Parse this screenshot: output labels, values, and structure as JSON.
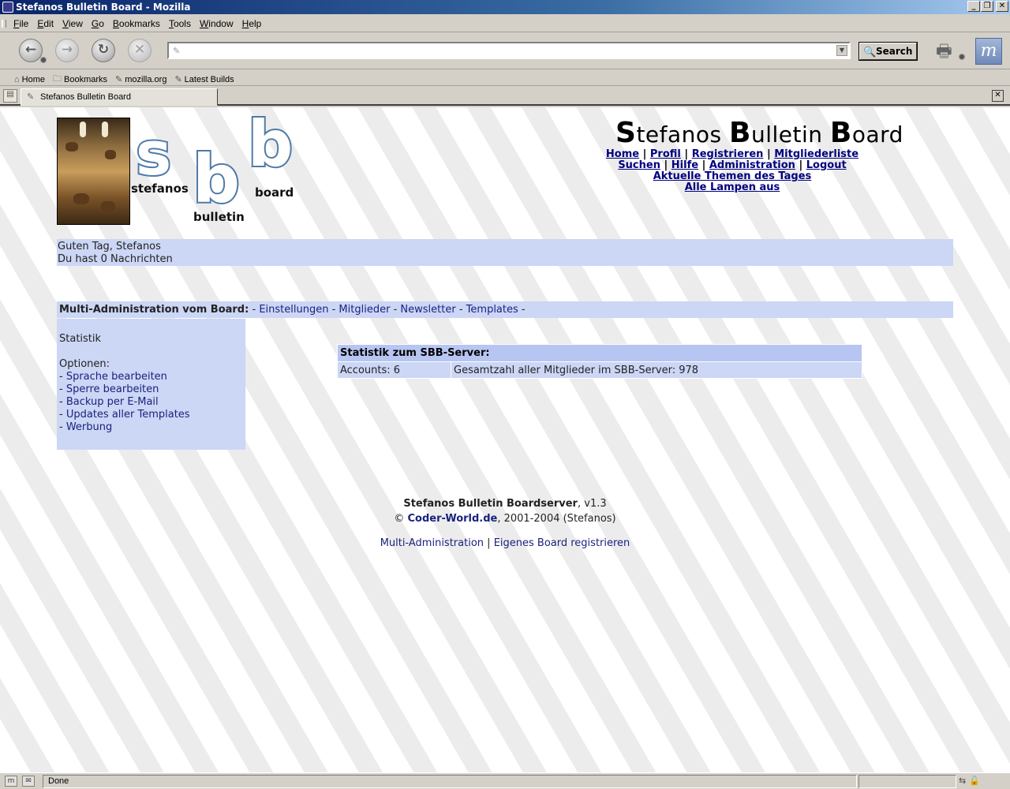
{
  "window": {
    "title": "Stefanos Bulletin Board - Mozilla"
  },
  "menu": {
    "items": [
      "File",
      "Edit",
      "View",
      "Go",
      "Bookmarks",
      "Tools",
      "Window",
      "Help"
    ]
  },
  "navbar": {
    "url_value": "",
    "search_label": "Search"
  },
  "personal_toolbar": {
    "items": [
      "Home",
      "Bookmarks",
      "mozilla.org",
      "Latest Builds"
    ]
  },
  "tab": {
    "title": "Stefanos Bulletin Board"
  },
  "page": {
    "logo": {
      "s": "s",
      "b1": "b",
      "b2": "b",
      "word1": "stefanos",
      "word2": "bulletin",
      "word3": "board"
    },
    "title": {
      "s_cap": "S",
      "s_rest": "tefanos ",
      "b_cap": "B",
      "b_rest": "ulletin ",
      "b2_cap": "B",
      "b2_rest": "oard"
    },
    "nav": {
      "home": "Home",
      "profil": "Profil",
      "registrieren": "Registrieren",
      "mitgliederliste": "Mitgliederliste",
      "suchen": "Suchen",
      "hilfe": "Hilfe",
      "administration": "Administration",
      "logout": "Logout",
      "themen": "Aktuelle Themen des Tages",
      "lampen": "Alle Lampen aus",
      "sep": "|"
    },
    "greeting": {
      "line1": "Guten Tag, Stefanos",
      "line2": "Du hast 0 Nachrichten"
    },
    "admin_bar": {
      "label": "Multi-Administration vom Board:",
      "dash": "-",
      "links": [
        "Einstellungen",
        "Mitglieder",
        "Newsletter",
        "Templates"
      ]
    },
    "side": {
      "statistik": "Statistik",
      "optionen_label": "Optionen:",
      "options": [
        "Sprache bearbeiten",
        "Sperre bearbeiten",
        "Backup per E-Mail",
        "Updates aller Templates",
        "Werbung"
      ],
      "prefix": "- "
    },
    "stats": {
      "header": "Statistik zum SBB-Server:",
      "accounts": "Accounts: 6",
      "total": "Gesamtzahl aller Mitglieder im SBB-Server: 978"
    },
    "footer": {
      "product": "Stefanos Bulletin Boardserver",
      "version": ", v1.3",
      "copy": "©",
      "site": "Coder-World.de",
      "years": ", 2001-2004 (Stefanos)",
      "link1": "Multi-Administration",
      "sep": "|",
      "link2": "Eigenes Board registrieren"
    }
  },
  "status": {
    "text": "Done"
  }
}
